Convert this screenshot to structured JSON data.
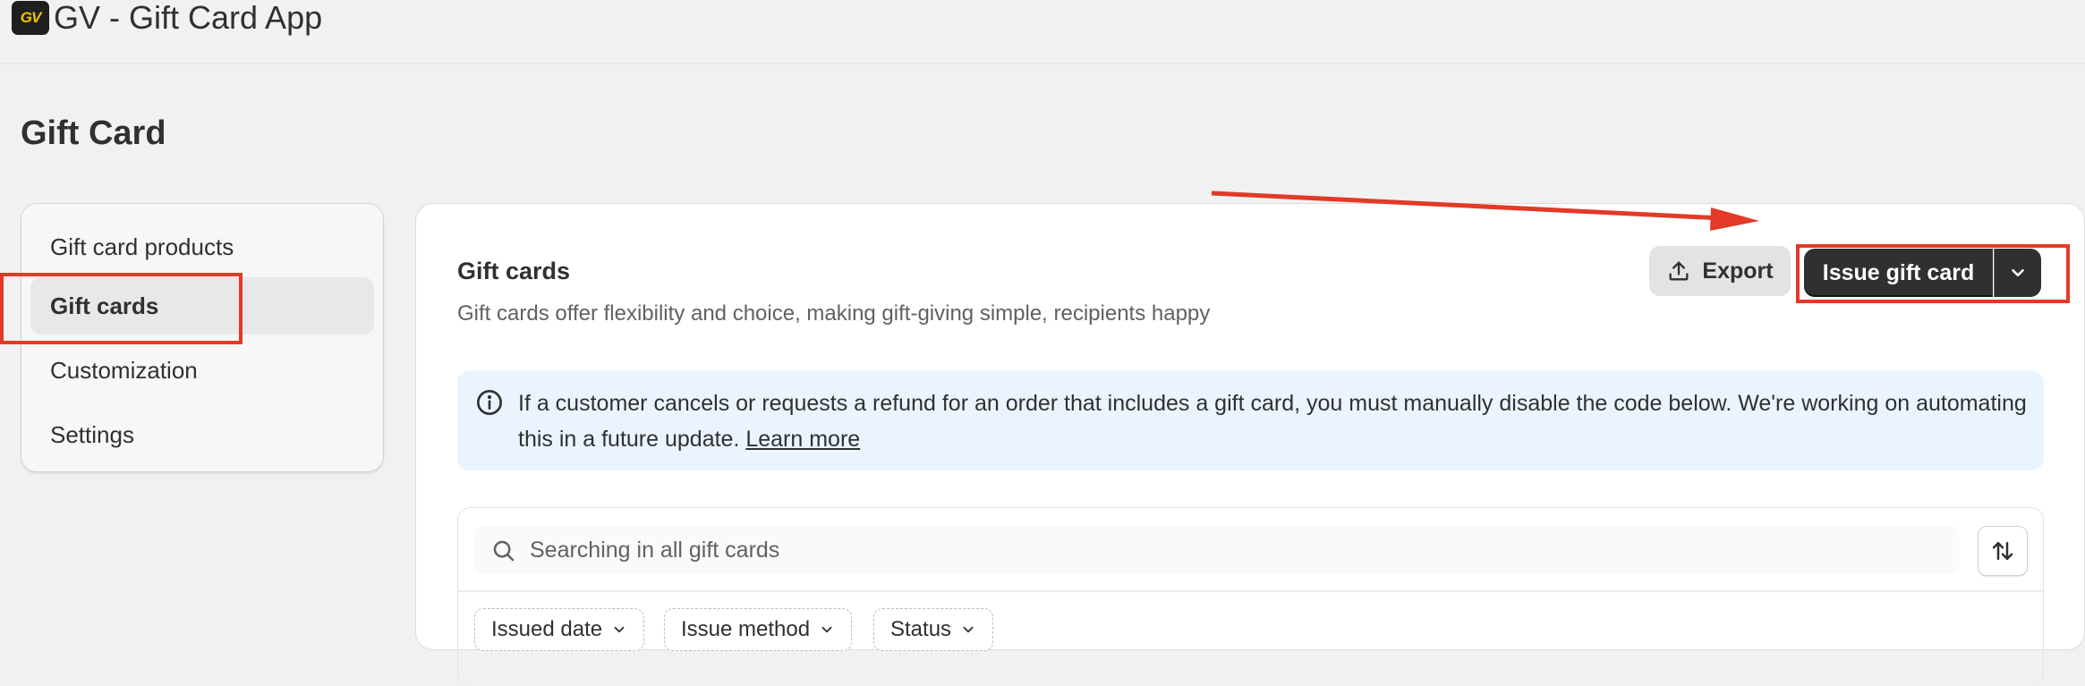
{
  "app": {
    "logo_text": "GV",
    "title": "GV - Gift Card App"
  },
  "page": {
    "title": "Gift Card"
  },
  "sidebar": {
    "items": [
      {
        "label": "Gift card products",
        "active": false
      },
      {
        "label": "Gift cards",
        "active": true
      },
      {
        "label": "Customization",
        "active": false
      },
      {
        "label": "Settings",
        "active": false
      }
    ]
  },
  "main": {
    "title": "Gift cards",
    "subtitle": "Gift cards offer flexibility and choice, making gift-giving simple, recipients happy",
    "export_label": "Export",
    "issue_label": "Issue gift card",
    "banner": {
      "text": "If a customer cancels or requests a refund for an order that includes a gift card, you must manually disable the code below. We're working on automating this in a future update.",
      "link": "Learn more"
    },
    "search": {
      "placeholder": "Searching in all gift cards"
    },
    "filters": [
      {
        "label": "Issued date"
      },
      {
        "label": "Issue method"
      },
      {
        "label": "Status"
      }
    ]
  },
  "colors": {
    "annotation": "#e23a26",
    "primary_button": "#303030",
    "banner_bg": "#eaf4ff"
  }
}
